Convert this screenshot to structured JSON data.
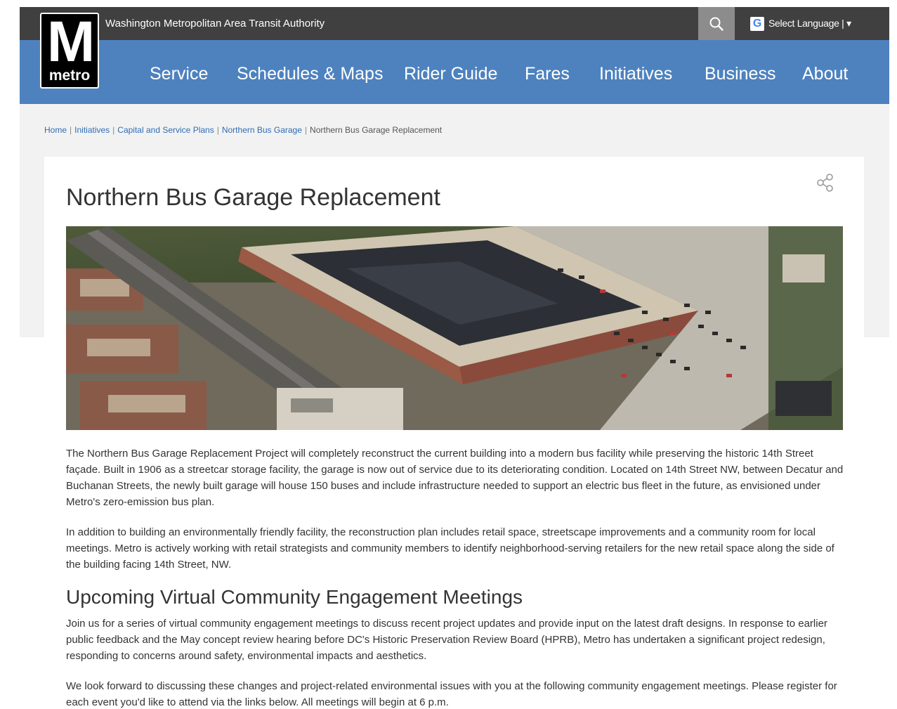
{
  "header": {
    "agency": "Washington Metropolitan Area Transit Authority",
    "search_icon": "search-icon",
    "language_label": "Select Language | ▾",
    "logo_letter": "M",
    "logo_word": "metro"
  },
  "nav": {
    "items": [
      {
        "label": "Service"
      },
      {
        "label": "Schedules & Maps"
      },
      {
        "label": "Rider Guide"
      },
      {
        "label": "Fares"
      },
      {
        "label": "Initiatives"
      },
      {
        "label": "Business"
      },
      {
        "label": "About"
      }
    ]
  },
  "breadcrumb": {
    "items": [
      {
        "label": "Home"
      },
      {
        "label": "Initiatives"
      },
      {
        "label": "Capital and Service Plans"
      },
      {
        "label": "Northern Bus Garage"
      },
      {
        "label": "Northern Bus Garage Replacement"
      }
    ]
  },
  "page": {
    "title": "Northern Bus Garage Replacement",
    "intro_1": "The Northern Bus Garage Replacement Project will completely reconstruct the current building into a modern bus facility while preserving the historic 14th Street façade. Built in 1906 as a streetcar storage facility, the garage is now out of service due to its deteriorating condition. Located on 14th Street NW, between Decatur and Buchanan Streets, the newly built garage will house 150 buses and include infrastructure needed to support an electric bus fleet in the future, as envisioned under Metro's zero-emission bus plan.",
    "intro_2": "In addition to building an environmentally friendly facility, the reconstruction plan includes retail space, streetscape improvements and a community room for local meetings. Metro is actively working with retail strategists and community members to identify neighborhood-serving retailers for the new retail space along the side of the building facing 14th Street, NW.",
    "section_title": "Upcoming Virtual Community Engagement Meetings",
    "section_p1": "Join us for a series of virtual community engagement meetings to discuss recent project updates and provide input on the latest draft designs. In response to earlier public feedback and the May concept review hearing before DC's Historic Preservation Review Board (HPRB), Metro has undertaken a significant project redesign, responding to concerns around safety, environmental impacts and aesthetics.",
    "section_p2": "We look forward to discussing these changes and project-related environmental issues with you at the following community engagement meetings. Please register for each event you'd like to attend via the links below. All meetings will begin at 6 p.m."
  },
  "colors": {
    "nav_blue": "#4d82bf",
    "util_gray": "#404040",
    "link_blue": "#2f6db3"
  }
}
